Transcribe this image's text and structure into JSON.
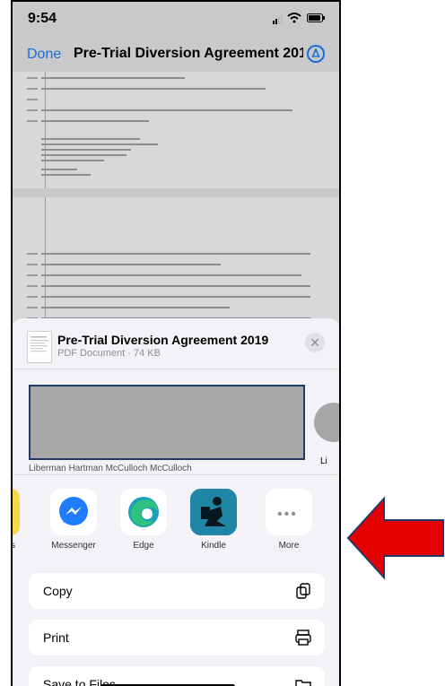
{
  "status_bar": {
    "time": "9:54"
  },
  "nav": {
    "done": "Done",
    "title": "Pre-Trial Diversion Agreement 201..."
  },
  "share_sheet": {
    "doc_title": "Pre-Trial Diversion Agreement 2019",
    "doc_subtitle": "PDF Document · 74 KB",
    "contact_right_label": "Li",
    "contact_names_partial": "Liberman    Hartman    McCulloch    McCulloch",
    "apps": [
      {
        "label": "s"
      },
      {
        "label": "Messenger"
      },
      {
        "label": "Edge"
      },
      {
        "label": "Kindle"
      },
      {
        "label": "More"
      }
    ],
    "actions": [
      {
        "label": "Copy"
      },
      {
        "label": "Print"
      },
      {
        "label": "Save to Files"
      }
    ]
  },
  "colors": {
    "accent": "#1a6fd8",
    "messenger": "#1f7cff",
    "kindle": "#1f86a6",
    "arrow": "#e50000"
  }
}
